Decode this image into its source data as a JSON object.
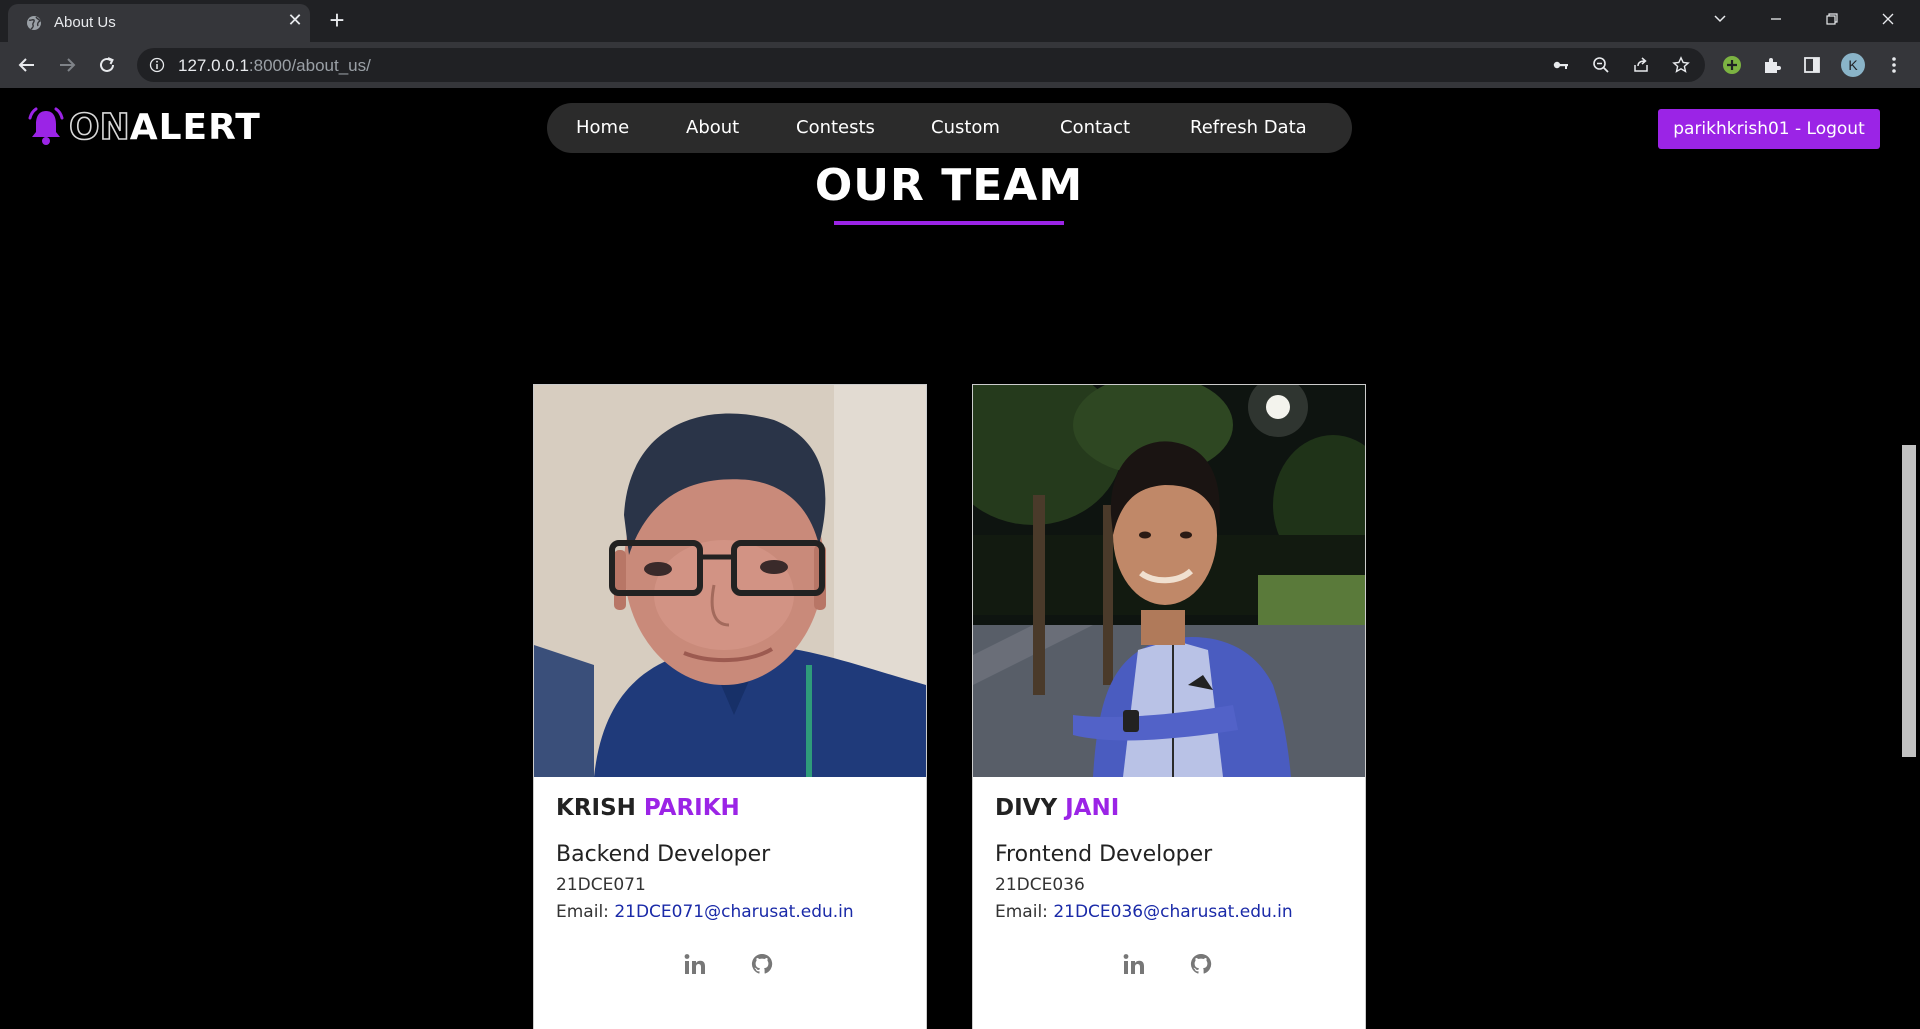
{
  "browser": {
    "tab_title": "About Us",
    "url_host": "127.0.0.1",
    "url_rest": ":8000/about_us/",
    "profile_initial": "K"
  },
  "site": {
    "logo_on": "ON",
    "logo_alert": "ALERT",
    "nav": [
      "Home",
      "About",
      "Contests",
      "Custom",
      "Contact",
      "Refresh Data"
    ],
    "logout_label": "parikhkrish01 - Logout",
    "accent_color": "#9b24e6"
  },
  "team": {
    "heading": "OUR TEAM",
    "members": [
      {
        "first": "KRISH",
        "last": "PARIKH",
        "role": "Backend Developer",
        "id": "21DCE071",
        "email_label": "Email:",
        "email": "21DCE071@charusat.edu.in"
      },
      {
        "first": "DIVY",
        "last": "JANI",
        "role": "Frontend Developer",
        "id": "21DCE036",
        "email_label": "Email:",
        "email": "21DCE036@charusat.edu.in"
      }
    ]
  }
}
